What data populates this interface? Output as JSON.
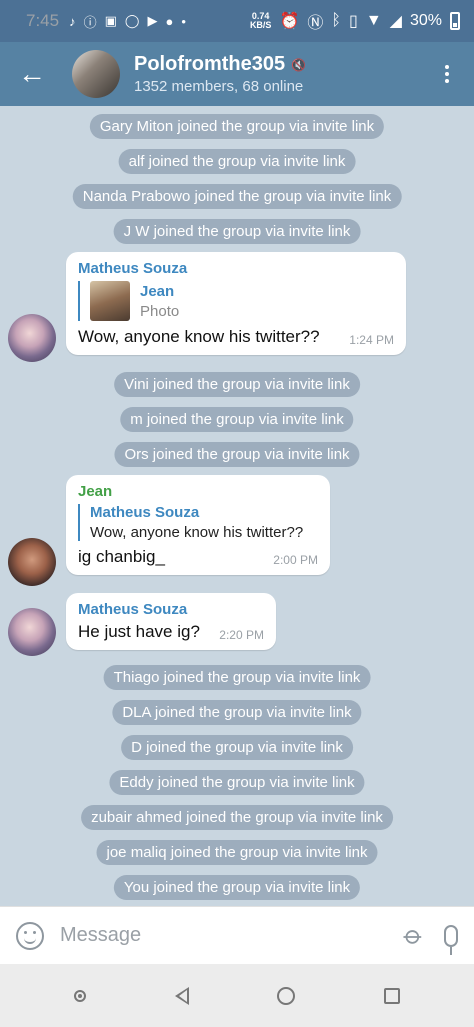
{
  "status_bar": {
    "time": "7:45",
    "net_speed_value": "0.74",
    "net_speed_unit": "KB/S",
    "battery": "30%"
  },
  "header": {
    "title": "Polofromthe305",
    "subtitle": "1352 members, 68 online"
  },
  "service_messages_top": [
    "Gary Miton joined the group via invite link",
    "alf joined the group via invite link",
    "Nanda Prabowo joined the group via invite link",
    "J W joined the group via invite link"
  ],
  "message1": {
    "sender": "Matheus Souza",
    "reply_name": "Jean",
    "reply_sub": "Photo",
    "text": "Wow, anyone know his twitter??",
    "time": "1:24 PM"
  },
  "service_messages_mid": [
    "Vini joined the group via invite link",
    "m joined the group via invite link",
    "Ors joined the group via invite link"
  ],
  "message2": {
    "sender": "Jean",
    "reply_name": "Matheus Souza",
    "reply_text": "Wow, anyone know his twitter??",
    "text": "ig chanbig_",
    "time": "2:00 PM"
  },
  "message3": {
    "sender": "Matheus Souza",
    "text": "He just have ig?",
    "time": "2:20 PM"
  },
  "service_messages_bottom": [
    "Thiago joined the group via invite link",
    "DLA joined the group via invite link",
    "D joined the group via invite link",
    "Eddy joined the group via invite link",
    "zubair ahmed joined the group via invite link",
    "joe maliq joined the group via invite link",
    "You joined the group via invite link"
  ],
  "input": {
    "placeholder": "Message"
  },
  "icons": {
    "back": "back-arrow-icon",
    "menu": "more-vert-icon",
    "emoji": "emoji-icon",
    "attach": "paperclip-icon",
    "mic": "mic-icon"
  },
  "colors": {
    "header": "#5682a3",
    "status_bar": "#4c7195",
    "sender_blue": "#3e88c0",
    "sender_green": "#43a047"
  }
}
